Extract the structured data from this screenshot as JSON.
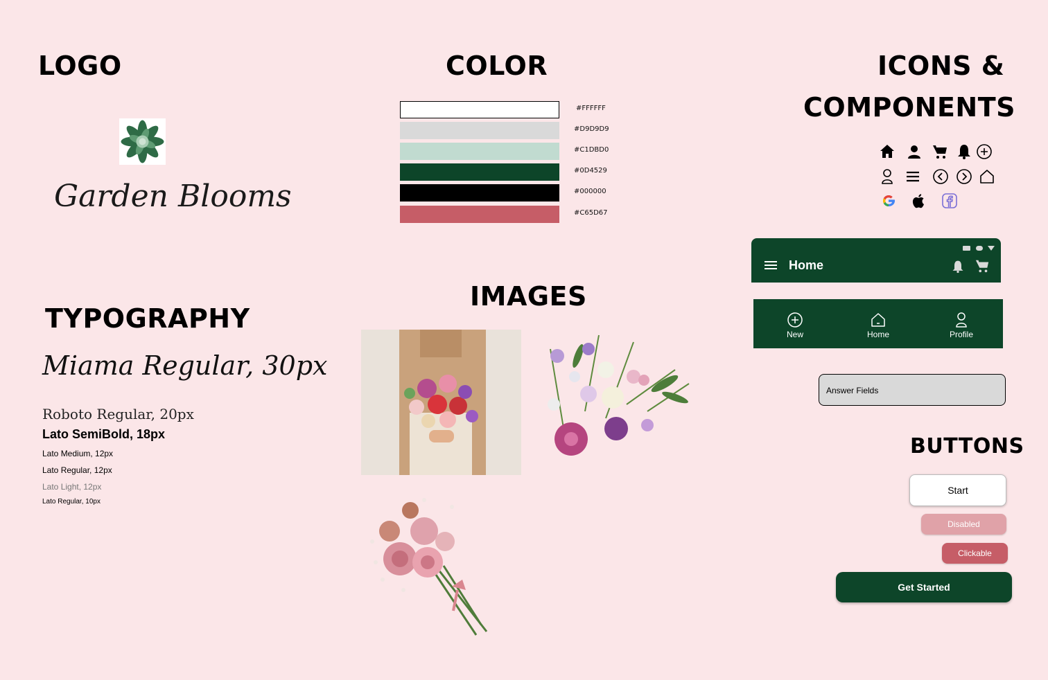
{
  "headings": {
    "logo": "LOGO",
    "color": "COLOR",
    "icons_line1": "ICONS &",
    "icons_line2": "COMPONENTS",
    "typography": "TYPOGRAPHY",
    "images": "IMAGES",
    "buttons": "BUTTONS"
  },
  "logo": {
    "brand_name": "Garden Blooms"
  },
  "colors": [
    {
      "hex": "#FFFFFF",
      "label": "#FFFFFF"
    },
    {
      "hex": "#D9D9D9",
      "label": "#D9D9D9"
    },
    {
      "hex": "#C1DBD0",
      "label": "#C1DBD0"
    },
    {
      "hex": "#0D4529",
      "label": "#0D4529"
    },
    {
      "hex": "#000000",
      "label": "#000000"
    },
    {
      "hex": "#C65D67",
      "label": "#C65D67"
    }
  ],
  "typography": [
    "Miama Regular, 30px",
    "Roboto Regular, 20px",
    "Lato SemiBold, 18px",
    "Lato Medium, 12px",
    "Lato Regular, 12px",
    "Lato Light, 12px",
    "Lato Regular, 10px"
  ],
  "icons": [
    "home-icon",
    "user-icon",
    "cart-icon",
    "bell-icon",
    "plus-circle-icon",
    "user-outline-icon",
    "menu-icon",
    "chevron-left-circle-icon",
    "chevron-right-circle-icon",
    "home-outline-icon",
    "google-icon",
    "apple-icon",
    "facebook-icon"
  ],
  "appbar": {
    "title": "Home"
  },
  "bottom_nav": [
    {
      "label": "New",
      "icon": "plus-circle-icon"
    },
    {
      "label": "Home",
      "icon": "home-outline-icon"
    },
    {
      "label": "Profile",
      "icon": "user-outline-icon"
    }
  ],
  "answer_field": {
    "value": "Answer Fields"
  },
  "buttons": {
    "start": "Start",
    "disabled": "Disabled",
    "clickable": "Clickable",
    "get_started": "Get Started"
  },
  "theme": {
    "background": "#FBE6E8",
    "primary": "#0D4529",
    "accent": "#C65D67",
    "disabled": "#E0A2A8"
  }
}
